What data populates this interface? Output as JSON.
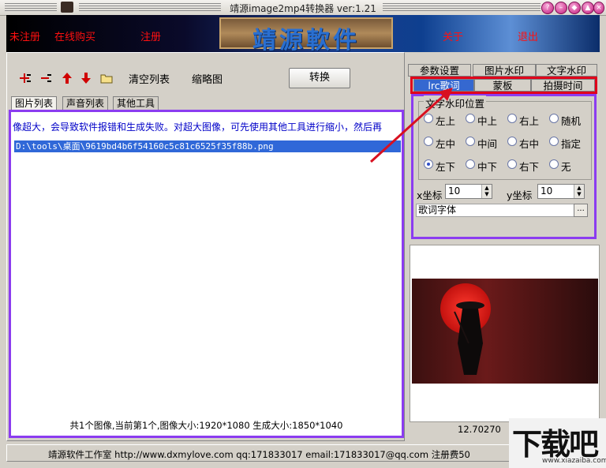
{
  "titlebar": {
    "title": "靖源image2mp4转换器 ver:1.21"
  },
  "banner": {
    "unregistered": "未注册",
    "buy_online": "在线购买",
    "register": "注册",
    "logo_text": "靖源軟件",
    "about": "关于",
    "exit": "退出"
  },
  "toolbar": {
    "clear_list": "清空列表",
    "thumbnail": "缩略图",
    "convert": "转换"
  },
  "left_tabs": [
    "图片列表",
    "声音列表",
    "其他工具"
  ],
  "list": {
    "notice": "像超大，会导致软件报错和生成失败。对超大图像，可先使用其他工具进行缩小，然后再",
    "files": [
      "D:\\tools\\桌面\\9619bd4b6f54160c5c81c6525f35f88b.png"
    ],
    "status": "共1个图像,当前第1个,图像大小:1920*1080 生成大小:1850*1040"
  },
  "right_tabs_top": [
    "参数设置",
    "图片水印",
    "文字水印"
  ],
  "right_tabs_bottom": [
    "lrc歌词",
    "蒙板",
    "拍摄时间"
  ],
  "watermark_panel": {
    "group_title": "文字水印位置",
    "positions": [
      "左上",
      "中上",
      "右上",
      "随机",
      "左中",
      "中间",
      "右中",
      "指定",
      "左下",
      "中下",
      "右下",
      "无"
    ],
    "selected": "左下",
    "x_label": "x坐标",
    "x_value": "10",
    "y_label": "y坐标",
    "y_value": "10",
    "font_label": "歌词字体",
    "font_button": "..."
  },
  "preview": {
    "value": "12.70270"
  },
  "status_bar": {
    "text": "靖源软件工作室 http://www.dxmylove.com qq:171833017 email:171833017@qq.com 注册费50"
  },
  "site_watermark": {
    "big": "下载吧",
    "small": "www.xiazaiba.com"
  },
  "colors": {
    "highlight_red": "#e0001a",
    "focus_purple": "#8b3cf0",
    "selection_blue": "#3068d8",
    "banner_red_text": "#ff1010"
  }
}
